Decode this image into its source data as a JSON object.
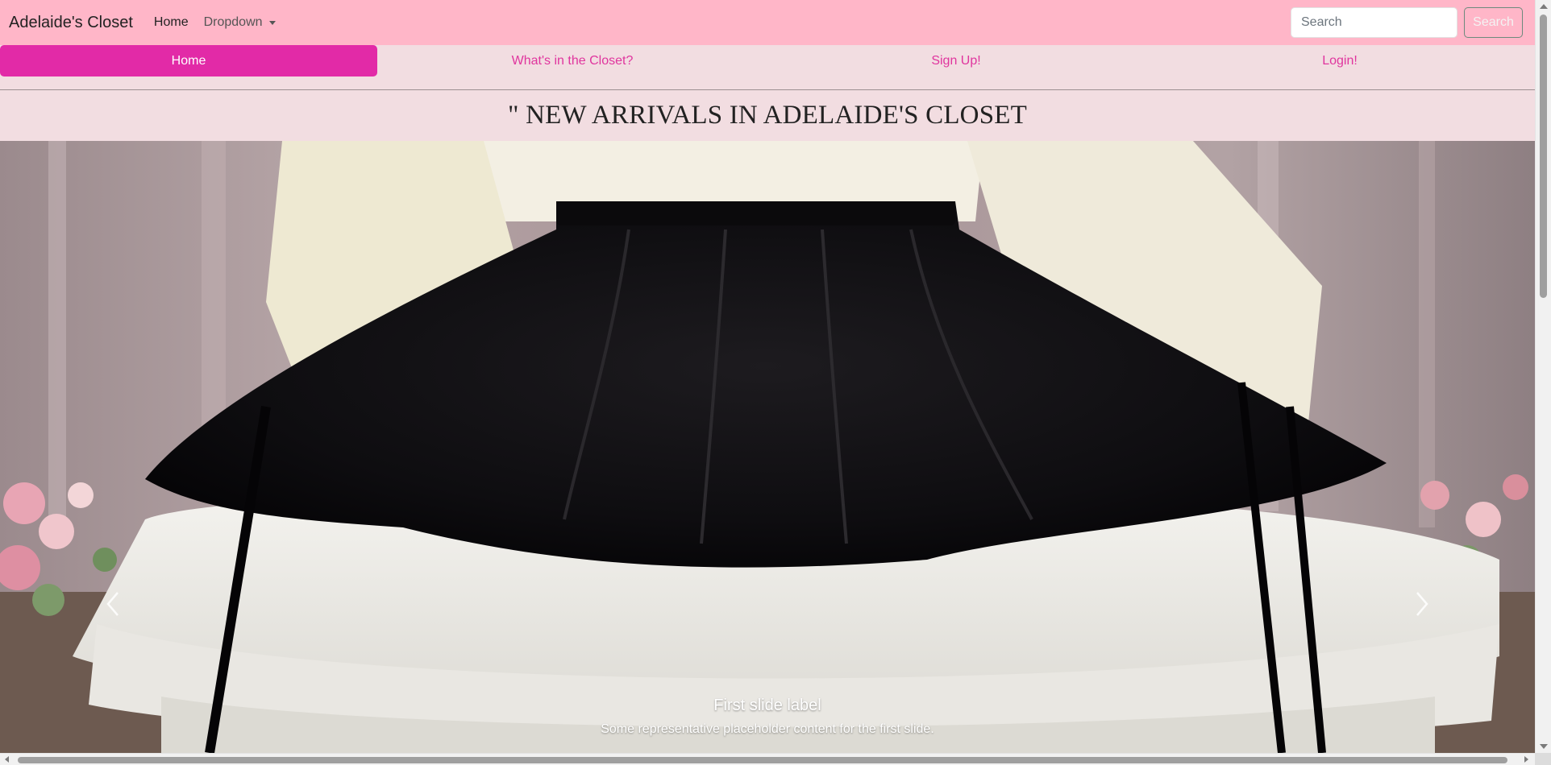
{
  "navbar": {
    "brand": "Adelaide's Closet",
    "links": [
      {
        "label": "Home"
      },
      {
        "label": "Dropdown"
      }
    ],
    "search": {
      "placeholder": "Search",
      "button_label": "Search"
    }
  },
  "pills": [
    {
      "label": "Home",
      "active": true
    },
    {
      "label": "What's in the Closet?",
      "active": false
    },
    {
      "label": "Sign Up!",
      "active": false
    },
    {
      "label": "Login!",
      "active": false
    }
  ],
  "heading": "\" NEW ARRIVALS IN ADELAIDE'S CLOSET",
  "carousel": {
    "slide": {
      "title": "First slide label",
      "text": "Some representative placeholder content for the first slide.",
      "image_subject": "black velvet skirt with white lace petticoat"
    },
    "prev_icon": "chevron-left-icon",
    "next_icon": "chevron-right-icon"
  },
  "colors": {
    "navbar_bg": "#ffb6c8",
    "pills_bg": "#f2dde1",
    "active_pill": "#e22aa7",
    "pill_text": "#e0359e"
  }
}
